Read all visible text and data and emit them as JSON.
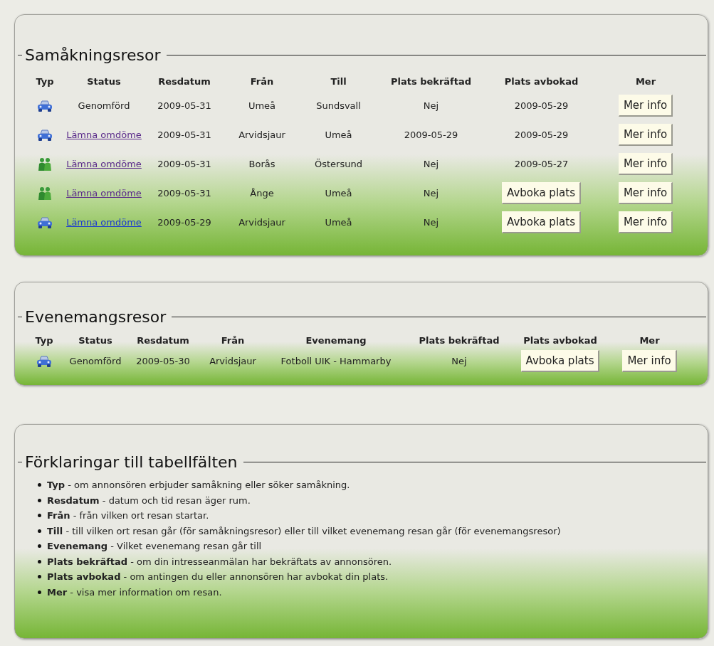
{
  "sections": [
    {
      "title": "Samåkningsresor",
      "kind": "table",
      "columns": [
        "Typ",
        "Status",
        "Resdatum",
        "Från",
        "Till",
        "Plats bekräftad",
        "Plats avbokad",
        "Mer"
      ],
      "rows": [
        {
          "cells": [
            {
              "kind": "car"
            },
            {
              "kind": "text",
              "text": "Genomförd"
            },
            {
              "kind": "text",
              "text": "2009-05-31"
            },
            {
              "kind": "text",
              "text": "Umeå"
            },
            {
              "kind": "text",
              "text": "Sundsvall"
            },
            {
              "kind": "text",
              "text": "Nej"
            },
            {
              "kind": "text",
              "text": "2009-05-29"
            },
            {
              "kind": "button",
              "text": "Mer info"
            }
          ]
        },
        {
          "cells": [
            {
              "kind": "car"
            },
            {
              "kind": "link",
              "text": "Lämna omdöme",
              "visited": true
            },
            {
              "kind": "text",
              "text": "2009-05-31"
            },
            {
              "kind": "text",
              "text": "Arvidsjaur"
            },
            {
              "kind": "text",
              "text": "Umeå"
            },
            {
              "kind": "text",
              "text": "2009-05-29"
            },
            {
              "kind": "text",
              "text": "2009-05-29"
            },
            {
              "kind": "button",
              "text": "Mer info"
            }
          ]
        },
        {
          "cells": [
            {
              "kind": "people"
            },
            {
              "kind": "link",
              "text": "Lämna omdöme",
              "visited": true
            },
            {
              "kind": "text",
              "text": "2009-05-31"
            },
            {
              "kind": "text",
              "text": "Borås"
            },
            {
              "kind": "text",
              "text": "Östersund"
            },
            {
              "kind": "text",
              "text": "Nej"
            },
            {
              "kind": "text",
              "text": "2009-05-27"
            },
            {
              "kind": "button",
              "text": "Mer info"
            }
          ]
        },
        {
          "cells": [
            {
              "kind": "people"
            },
            {
              "kind": "link",
              "text": "Lämna omdöme",
              "visited": true
            },
            {
              "kind": "text",
              "text": "2009-05-31"
            },
            {
              "kind": "text",
              "text": "Ånge"
            },
            {
              "kind": "text",
              "text": "Umeå"
            },
            {
              "kind": "text",
              "text": "Nej"
            },
            {
              "kind": "button",
              "text": "Avboka plats"
            },
            {
              "kind": "button",
              "text": "Mer info"
            }
          ]
        },
        {
          "cells": [
            {
              "kind": "car"
            },
            {
              "kind": "link",
              "text": "Lämna omdöme",
              "visited": false
            },
            {
              "kind": "text",
              "text": "2009-05-29"
            },
            {
              "kind": "text",
              "text": "Arvidsjaur"
            },
            {
              "kind": "text",
              "text": "Umeå"
            },
            {
              "kind": "text",
              "text": "Nej"
            },
            {
              "kind": "button",
              "text": "Avboka plats"
            },
            {
              "kind": "button",
              "text": "Mer info"
            }
          ]
        }
      ]
    },
    {
      "title": "Evenemangsresor",
      "kind": "table",
      "columns": [
        "Typ",
        "Status",
        "Resdatum",
        "Från",
        "Evenemang",
        "Plats bekräftad",
        "Plats avbokad",
        "Mer"
      ],
      "rows": [
        {
          "cells": [
            {
              "kind": "car"
            },
            {
              "kind": "text",
              "text": "Genomförd"
            },
            {
              "kind": "text",
              "text": "2009-05-30"
            },
            {
              "kind": "text",
              "text": "Arvidsjaur"
            },
            {
              "kind": "text",
              "text": "Fotboll UIK - Hammarby"
            },
            {
              "kind": "text",
              "text": "Nej"
            },
            {
              "kind": "button",
              "text": "Avboka plats"
            },
            {
              "kind": "button",
              "text": "Mer info"
            }
          ]
        }
      ]
    },
    {
      "title": "Förklaringar till tabellfälten",
      "kind": "list",
      "items": [
        "**Typ** - om annonsören erbjuder samåkning eller söker samåkning.",
        "**Resdatum** - datum och tid resan äger rum.",
        "**Från** - från vilken ort resan startar.",
        "**Till** - till vilken ort resan går (för samåkningsresor) eller till vilket evenemang resan går (för evenemangsresor)",
        "**Evenemang** - Vilket evenemang resan går till",
        "**Plats bekräftad** - om din intresseanmälan har bekräftats av annonsören.",
        "**Plats avbokad** - om antingen du eller annonsören har avbokat din plats.",
        "**Mer** - visa mer information om resan."
      ]
    }
  ]
}
